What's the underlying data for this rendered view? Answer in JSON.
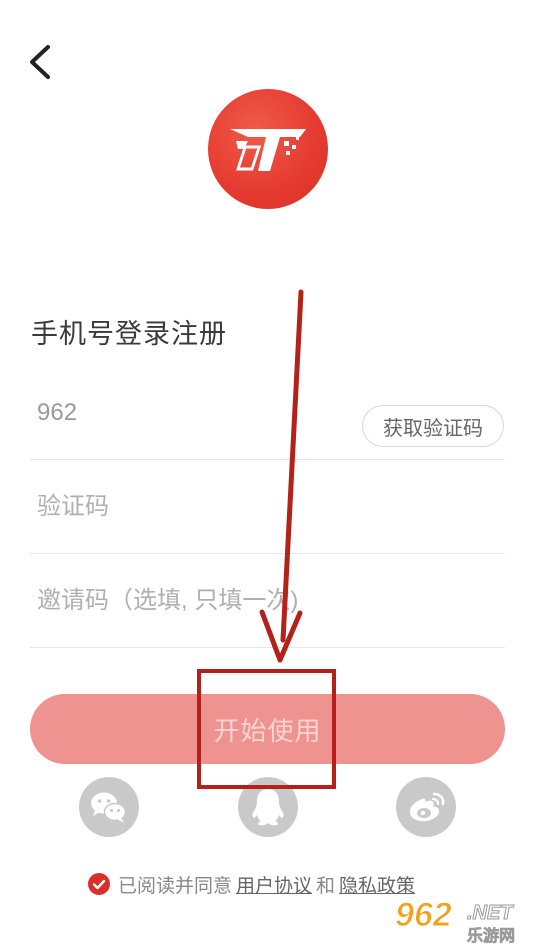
{
  "header": {
    "back_icon": "chevron-left-icon",
    "logo_icon": "app-logo"
  },
  "login": {
    "title": "手机号登录注册",
    "phone": {
      "value": "962",
      "get_code_label": "获取验证码"
    },
    "code": {
      "placeholder": "验证码"
    },
    "invite": {
      "placeholder": "邀请码（选填, 只填一次)"
    },
    "start_label": "开始使用"
  },
  "social": [
    {
      "icon": "wechat-icon"
    },
    {
      "icon": "qq-icon"
    },
    {
      "icon": "weibo-icon"
    }
  ],
  "agreement": {
    "checked": true,
    "prefix": "已阅读并同意",
    "user_agreement": "用户协议",
    "and": "和",
    "privacy_policy": "隐私政策"
  },
  "watermark": {
    "big": "962",
    "net": ".NET",
    "cn": "乐游网"
  },
  "colors": {
    "brand_red": "#e43a2f",
    "button_pink": "#ef9390",
    "annotation_red": "#b32119",
    "social_gray": "#c9c9c9"
  }
}
